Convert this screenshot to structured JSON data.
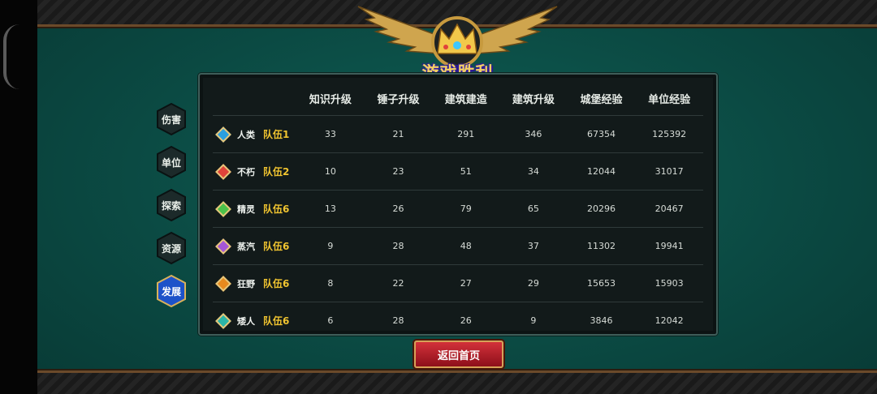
{
  "victory": {
    "title": "游戏胜利"
  },
  "tabs": [
    {
      "label": "伤害",
      "active": false
    },
    {
      "label": "单位",
      "active": false
    },
    {
      "label": "探索",
      "active": false
    },
    {
      "label": "资源",
      "active": false
    },
    {
      "label": "发展",
      "active": true
    }
  ],
  "table": {
    "headers": [
      "知识升级",
      "锤子升级",
      "建筑建造",
      "建筑升级",
      "城堡经验",
      "单位经验"
    ],
    "rows": [
      {
        "race": "人类",
        "team": "队伍1",
        "gem": "#2a9fe0",
        "values": [
          "33",
          "21",
          "291",
          "346",
          "67354",
          "125392"
        ]
      },
      {
        "race": "不朽",
        "team": "队伍2",
        "gem": "#e0433a",
        "values": [
          "10",
          "23",
          "51",
          "34",
          "12044",
          "31017"
        ]
      },
      {
        "race": "精灵",
        "team": "队伍6",
        "gem": "#4cc24a",
        "values": [
          "13",
          "26",
          "79",
          "65",
          "20296",
          "20467"
        ]
      },
      {
        "race": "蒸汽",
        "team": "队伍6",
        "gem": "#a556d6",
        "values": [
          "9",
          "28",
          "48",
          "37",
          "11302",
          "19941"
        ]
      },
      {
        "race": "狂野",
        "team": "队伍6",
        "gem": "#e88a1e",
        "values": [
          "8",
          "22",
          "27",
          "29",
          "15653",
          "15903"
        ]
      },
      {
        "race": "矮人",
        "team": "队伍6",
        "gem": "#2bb5a8",
        "values": [
          "6",
          "28",
          "26",
          "9",
          "3846",
          "12042"
        ]
      }
    ]
  },
  "return_button": {
    "label": "返回首页"
  },
  "colors": {
    "team_text": "#f0c430",
    "active_tab": "#1d52c9",
    "tab": "#1c2a2a",
    "return_button": "#c0202c"
  },
  "icons": {
    "emblem": "winged-crown-icon",
    "tab_shape": "hexagon-icon",
    "race_marker": "diamond-gem-icon"
  }
}
